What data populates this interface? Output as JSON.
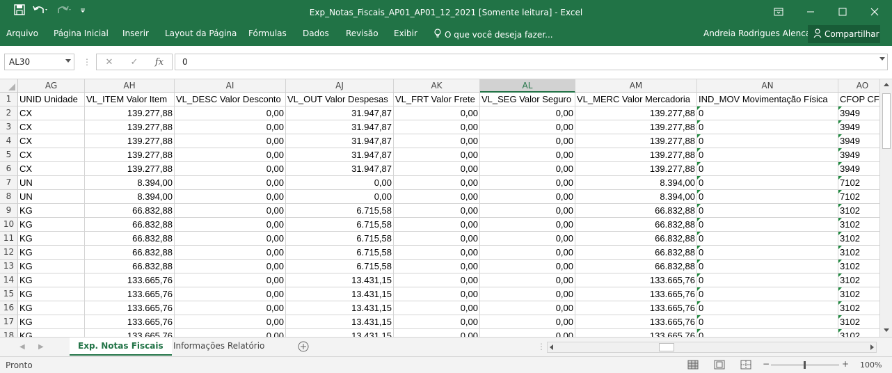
{
  "title": "Exp_Notas_Fiscais_AP01_AP01_12_2021  [Somente leitura] - Excel",
  "ribbon_tabs": [
    "Arquivo",
    "Página Inicial",
    "Inserir",
    "Layout da Página",
    "Fórmulas",
    "Dados",
    "Revisão",
    "Exibir"
  ],
  "tell_me": "O que você deseja fazer...",
  "user_name": "Andreia Rodrigues Alencar",
  "share_label": "Compartilhar",
  "name_box": "AL30",
  "formula_value": "0",
  "fx_label": "fx",
  "columns": [
    {
      "letter": "AG",
      "selected": false
    },
    {
      "letter": "AH",
      "selected": false
    },
    {
      "letter": "AI",
      "selected": false
    },
    {
      "letter": "AJ",
      "selected": false
    },
    {
      "letter": "AK",
      "selected": false
    },
    {
      "letter": "AL",
      "selected": true
    },
    {
      "letter": "AM",
      "selected": false
    },
    {
      "letter": "AN",
      "selected": false
    },
    {
      "letter": "AO",
      "selected": false
    }
  ],
  "rows": [
    {
      "n": "1",
      "cells": [
        "UNID Unidade",
        "VL_ITEM Valor Item",
        "VL_DESC Valor Desconto",
        "VL_OUT Valor Despesas",
        "VL_FRT Valor Frete",
        "VL_SEG Valor Seguro",
        "VL_MERC Valor Mercadoria",
        "IND_MOV Movimentação Física",
        "CFOP CFOP"
      ]
    },
    {
      "n": "2",
      "cells": [
        "CX",
        "139.277,88",
        "0,00",
        "31.947,87",
        "0,00",
        "0,00",
        "139.277,88",
        "0",
        "3949"
      ]
    },
    {
      "n": "3",
      "cells": [
        "CX",
        "139.277,88",
        "0,00",
        "31.947,87",
        "0,00",
        "0,00",
        "139.277,88",
        "0",
        "3949"
      ]
    },
    {
      "n": "4",
      "cells": [
        "CX",
        "139.277,88",
        "0,00",
        "31.947,87",
        "0,00",
        "0,00",
        "139.277,88",
        "0",
        "3949"
      ]
    },
    {
      "n": "5",
      "cells": [
        "CX",
        "139.277,88",
        "0,00",
        "31.947,87",
        "0,00",
        "0,00",
        "139.277,88",
        "0",
        "3949"
      ]
    },
    {
      "n": "6",
      "cells": [
        "CX",
        "139.277,88",
        "0,00",
        "31.947,87",
        "0,00",
        "0,00",
        "139.277,88",
        "0",
        "3949"
      ]
    },
    {
      "n": "7",
      "cells": [
        "UN",
        "8.394,00",
        "0,00",
        "0,00",
        "0,00",
        "0,00",
        "8.394,00",
        "0",
        "7102"
      ]
    },
    {
      "n": "8",
      "cells": [
        "UN",
        "8.394,00",
        "0,00",
        "0,00",
        "0,00",
        "0,00",
        "8.394,00",
        "0",
        "7102"
      ]
    },
    {
      "n": "9",
      "cells": [
        "KG",
        "66.832,88",
        "0,00",
        "6.715,58",
        "0,00",
        "0,00",
        "66.832,88",
        "0",
        "3102"
      ]
    },
    {
      "n": "10",
      "cells": [
        "KG",
        "66.832,88",
        "0,00",
        "6.715,58",
        "0,00",
        "0,00",
        "66.832,88",
        "0",
        "3102"
      ]
    },
    {
      "n": "11",
      "cells": [
        "KG",
        "66.832,88",
        "0,00",
        "6.715,58",
        "0,00",
        "0,00",
        "66.832,88",
        "0",
        "3102"
      ]
    },
    {
      "n": "12",
      "cells": [
        "KG",
        "66.832,88",
        "0,00",
        "6.715,58",
        "0,00",
        "0,00",
        "66.832,88",
        "0",
        "3102"
      ]
    },
    {
      "n": "13",
      "cells": [
        "KG",
        "66.832,88",
        "0,00",
        "6.715,58",
        "0,00",
        "0,00",
        "66.832,88",
        "0",
        "3102"
      ]
    },
    {
      "n": "14",
      "cells": [
        "KG",
        "133.665,76",
        "0,00",
        "13.431,15",
        "0,00",
        "0,00",
        "133.665,76",
        "0",
        "3102"
      ]
    },
    {
      "n": "15",
      "cells": [
        "KG",
        "133.665,76",
        "0,00",
        "13.431,15",
        "0,00",
        "0,00",
        "133.665,76",
        "0",
        "3102"
      ]
    },
    {
      "n": "16",
      "cells": [
        "KG",
        "133.665,76",
        "0,00",
        "13.431,15",
        "0,00",
        "0,00",
        "133.665,76",
        "0",
        "3102"
      ]
    },
    {
      "n": "17",
      "cells": [
        "KG",
        "133.665,76",
        "0,00",
        "13.431,15",
        "0,00",
        "0,00",
        "133.665,76",
        "0",
        "3102"
      ]
    },
    {
      "n": "18",
      "cells": [
        "KG",
        "133.665,76",
        "0,00",
        "13.431,15",
        "0,00",
        "0,00",
        "133.665,76",
        "0",
        "3102"
      ]
    }
  ],
  "sheet_tabs": [
    {
      "label": "Exp. Notas Fiscais",
      "active": true
    },
    {
      "label": "Informações Relatório",
      "active": false
    }
  ],
  "status_text": "Pronto",
  "zoom": "100%",
  "colors": {
    "accent": "#217346"
  }
}
